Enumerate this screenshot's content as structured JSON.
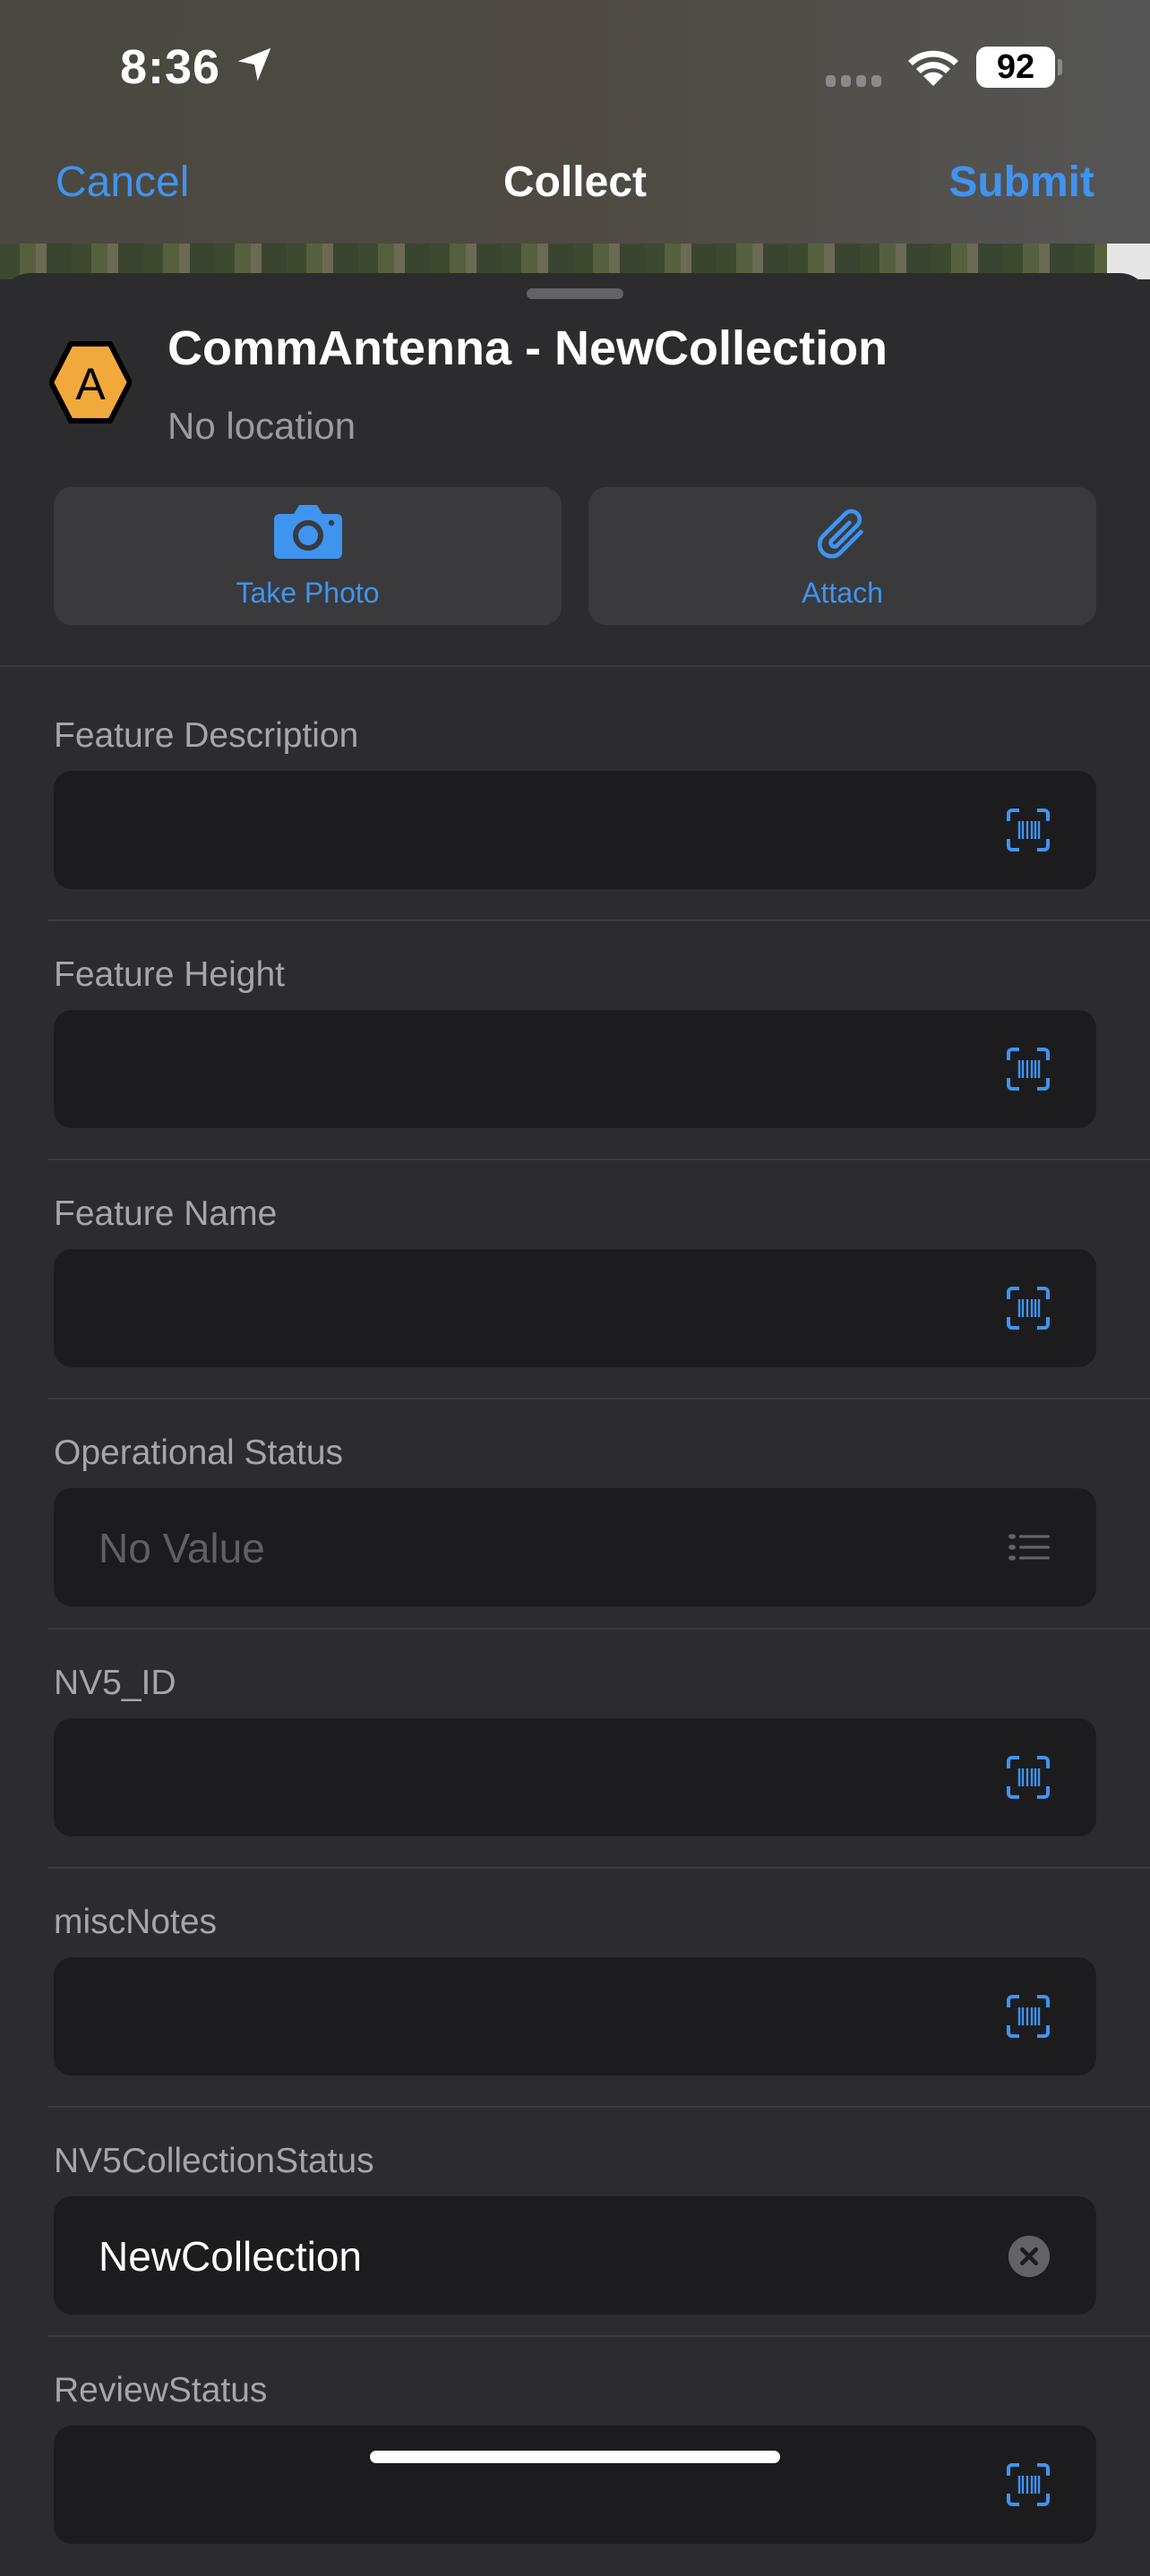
{
  "status_bar": {
    "time": "8:36",
    "battery": "92"
  },
  "nav": {
    "cancel": "Cancel",
    "title": "Collect",
    "submit": "Submit"
  },
  "header": {
    "icon_letter": "A",
    "title": "CommAntenna - NewCollection",
    "subtitle": "No location",
    "icon_color": "#f2a93b"
  },
  "actions": {
    "take_photo": "Take Photo",
    "attach": "Attach"
  },
  "accent": "#3f94f0",
  "fields": [
    {
      "label": "Feature Description",
      "value": "",
      "icon": "barcode-scan-icon"
    },
    {
      "label": "Feature Height",
      "value": "",
      "icon": "barcode-scan-icon"
    },
    {
      "label": "Feature Name",
      "value": "",
      "icon": "barcode-scan-icon"
    },
    {
      "label": "Operational Status",
      "value": "",
      "placeholder": "No Value",
      "icon": "list-icon"
    },
    {
      "label": "NV5_ID",
      "value": "",
      "icon": "barcode-scan-icon"
    },
    {
      "label": "miscNotes",
      "value": "",
      "icon": "barcode-scan-icon"
    },
    {
      "label": "NV5CollectionStatus",
      "value": "NewCollection",
      "icon": "clear-icon"
    },
    {
      "label": "ReviewStatus",
      "value": "",
      "icon": "barcode-scan-icon"
    }
  ]
}
